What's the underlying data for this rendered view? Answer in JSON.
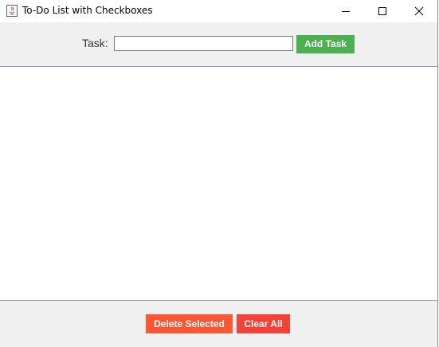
{
  "window": {
    "title": "To-Do List with Checkboxes",
    "controls": {
      "minimize": "minimize-icon",
      "maximize": "maximize-icon",
      "close": "close-icon"
    }
  },
  "toolbar": {
    "task_label": "Task:",
    "task_input_value": "",
    "add_button_label": "Add Task"
  },
  "tasks": [],
  "footer": {
    "delete_button_label": "Delete Selected",
    "clear_button_label": "Clear All"
  },
  "colors": {
    "add_button": "#4caf50",
    "delete_button": "#ff5733",
    "clear_button": "#f44336",
    "panel_background": "#f0f0f0"
  }
}
